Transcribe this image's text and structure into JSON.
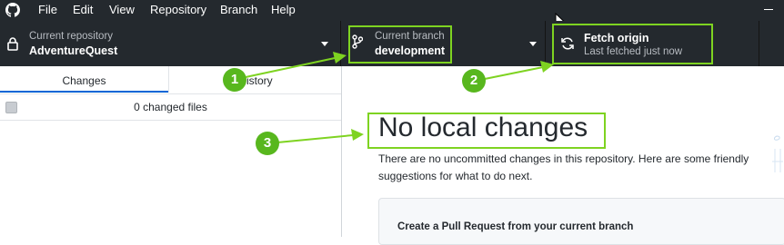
{
  "menu": {
    "items": [
      "File",
      "Edit",
      "View",
      "Repository",
      "Branch",
      "Help"
    ]
  },
  "toolbar": {
    "repository": {
      "label": "Current repository",
      "value": "AdventureQuest"
    },
    "branch": {
      "label": "Current branch",
      "value": "development"
    },
    "fetch": {
      "label": "Fetch origin",
      "status": "Last fetched just now"
    }
  },
  "sidebar": {
    "tabs": [
      {
        "label": "Changes",
        "active": true
      },
      {
        "label": "History",
        "active": false
      }
    ],
    "changed_files": "0 changed files"
  },
  "main": {
    "title": "No local changes",
    "description": "There are no uncommitted changes in this repository. Here are some friendly suggestions for what to do next.",
    "suggestion_title": "Create a Pull Request from your current branch"
  },
  "annotations": {
    "callouts": [
      "1",
      "2",
      "3"
    ],
    "highlight_color": "#7ed321",
    "callout_color": "#58b71e"
  },
  "colors": {
    "toolbar_bg": "#24292e",
    "active_tab_underline": "#0366d6"
  },
  "icons": [
    "github-logo-icon",
    "lock-icon",
    "branch-icon",
    "sync-icon",
    "chevron-down-icon",
    "cursor-icon"
  ]
}
